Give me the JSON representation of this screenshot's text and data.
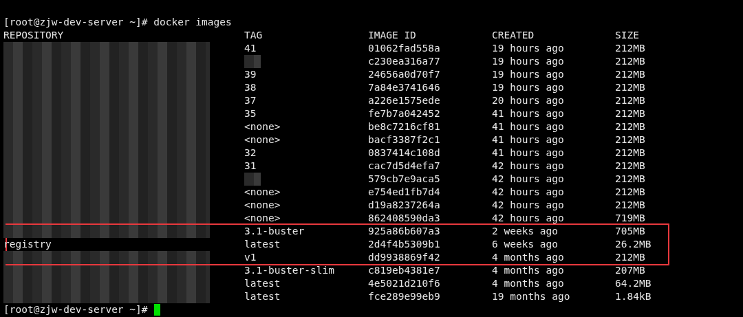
{
  "terminal": {
    "command_prompt": "[root@zjw-dev-server ~]# docker images",
    "columns": [
      "REPOSITORY",
      "TAG",
      "IMAGE ID",
      "CREATED",
      "SIZE"
    ],
    "rows": [
      {
        "repository": {
          "kind": "redacted"
        },
        "tag": {
          "kind": "text",
          "text": "41"
        },
        "image_id": "01062fad558a",
        "created": "19 hours ago",
        "size": "212MB",
        "highlighted": false
      },
      {
        "repository": {
          "kind": "redacted"
        },
        "tag": {
          "kind": "redacted"
        },
        "image_id": "c230ea316a77",
        "created": "19 hours ago",
        "size": "212MB",
        "highlighted": false
      },
      {
        "repository": {
          "kind": "redacted"
        },
        "tag": {
          "kind": "text",
          "text": "39"
        },
        "image_id": "24656a0d70f7",
        "created": "19 hours ago",
        "size": "212MB",
        "highlighted": false
      },
      {
        "repository": {
          "kind": "redacted"
        },
        "tag": {
          "kind": "text",
          "text": "38"
        },
        "image_id": "7a84e3741646",
        "created": "19 hours ago",
        "size": "212MB",
        "highlighted": false
      },
      {
        "repository": {
          "kind": "redacted"
        },
        "tag": {
          "kind": "text",
          "text": "37"
        },
        "image_id": "a226e1575ede",
        "created": "20 hours ago",
        "size": "212MB",
        "highlighted": false
      },
      {
        "repository": {
          "kind": "redacted"
        },
        "tag": {
          "kind": "text",
          "text": "35"
        },
        "image_id": "fe7b7a042452",
        "created": "41 hours ago",
        "size": "212MB",
        "highlighted": false
      },
      {
        "repository": {
          "kind": "redacted"
        },
        "tag": {
          "kind": "text",
          "text": "<none>"
        },
        "image_id": "be8c7216cf81",
        "created": "41 hours ago",
        "size": "212MB",
        "highlighted": false
      },
      {
        "repository": {
          "kind": "redacted"
        },
        "tag": {
          "kind": "text",
          "text": "<none>"
        },
        "image_id": "bacf3387f2c1",
        "created": "41 hours ago",
        "size": "212MB",
        "highlighted": false
      },
      {
        "repository": {
          "kind": "redacted"
        },
        "tag": {
          "kind": "text",
          "text": "32"
        },
        "image_id": "0837414c108d",
        "created": "41 hours ago",
        "size": "212MB",
        "highlighted": false
      },
      {
        "repository": {
          "kind": "redacted"
        },
        "tag": {
          "kind": "text",
          "text": "31"
        },
        "image_id": "cac7d5d4efa7",
        "created": "42 hours ago",
        "size": "212MB",
        "highlighted": false
      },
      {
        "repository": {
          "kind": "redacted"
        },
        "tag": {
          "kind": "redacted"
        },
        "image_id": "579cb7e9aca5",
        "created": "42 hours ago",
        "size": "212MB",
        "highlighted": false
      },
      {
        "repository": {
          "kind": "redacted"
        },
        "tag": {
          "kind": "text",
          "text": "<none>"
        },
        "image_id": "e754ed1fb7d4",
        "created": "42 hours ago",
        "size": "212MB",
        "highlighted": false
      },
      {
        "repository": {
          "kind": "redacted"
        },
        "tag": {
          "kind": "text",
          "text": "<none>"
        },
        "image_id": "d19a8237264a",
        "created": "42 hours ago",
        "size": "212MB",
        "highlighted": false
      },
      {
        "repository": {
          "kind": "redacted"
        },
        "tag": {
          "kind": "text",
          "text": "<none>"
        },
        "image_id": "862408590da3",
        "created": "42 hours ago",
        "size": "719MB",
        "highlighted": false
      },
      {
        "repository": {
          "kind": "redacted"
        },
        "tag": {
          "kind": "text",
          "text": "3.1-buster"
        },
        "image_id": "925a86b607a3",
        "created": "2 weeks ago",
        "size": "705MB",
        "highlighted": true
      },
      {
        "repository": {
          "kind": "text",
          "text": "registry"
        },
        "tag": {
          "kind": "text",
          "text": "latest"
        },
        "image_id": "2d4f4b5309b1",
        "created": "6 weeks ago",
        "size": "26.2MB",
        "highlighted": true
      },
      {
        "repository": {
          "kind": "redacted"
        },
        "tag": {
          "kind": "text",
          "text": "v1"
        },
        "image_id": "dd9938869f42",
        "created": "4 months ago",
        "size": "212MB",
        "highlighted": true
      },
      {
        "repository": {
          "kind": "redacted"
        },
        "tag": {
          "kind": "text",
          "text": "3.1-buster-slim"
        },
        "image_id": "c819eb4381e7",
        "created": "4 months ago",
        "size": "207MB",
        "highlighted": false
      },
      {
        "repository": {
          "kind": "redacted"
        },
        "tag": {
          "kind": "text",
          "text": "latest"
        },
        "image_id": "4e5021d210f6",
        "created": "4 months ago",
        "size": "64.2MB",
        "highlighted": false
      },
      {
        "repository": {
          "kind": "redacted"
        },
        "tag": {
          "kind": "text",
          "text": "latest"
        },
        "image_id": "fce289e99eb9",
        "created": "19 months ago",
        "size": "1.84kB",
        "highlighted": false
      }
    ],
    "final_prompt": "[root@zjw-dev-server ~]#"
  }
}
